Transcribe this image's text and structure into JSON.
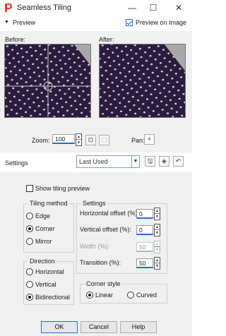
{
  "window": {
    "title": "Seamless Tiling",
    "minimize_glyph": "—",
    "maximize_glyph": "☐",
    "close_glyph": "✕"
  },
  "preview": {
    "header_label": "Preview",
    "preview_on_image_label": "Preview on Image",
    "preview_on_image_checked": true,
    "before_label": "Before:",
    "after_label": "After:",
    "zoom_label": "Zoom:",
    "zoom_value": "100",
    "pan_label": "Pan:",
    "pan_glyph": "+"
  },
  "settings": {
    "label": "Settings",
    "preset_value": "Last Used"
  },
  "tiling": {
    "show_tiling_preview_label": "Show tiling preview",
    "show_tiling_preview_checked": false,
    "method_title": "Tiling method",
    "methods": [
      "Edge",
      "Corner",
      "Mirror"
    ],
    "method_selected": "Corner",
    "direction_title": "Direction",
    "directions": [
      "Horizontal",
      "Vertical",
      "Bidirectional"
    ],
    "direction_selected": "Bidirectional",
    "settings_title": "Settings",
    "horizontal_offset_label": "Horizontal offset (%):",
    "horizontal_offset_value": "0",
    "vertical_offset_label": "Vertical offset (%):",
    "vertical_offset_value": "0",
    "width_label": "Width (%):",
    "width_value": "50",
    "transition_label": "Transition (%):",
    "transition_value": "50",
    "corner_style_title": "Corner style",
    "corner_styles": [
      "Linear",
      "Curved"
    ],
    "corner_style_selected": "Linear"
  },
  "buttons": {
    "ok": "OK",
    "cancel": "Cancel",
    "help": "Help"
  },
  "colors": {
    "accent": "#1f6fd1",
    "fabric": "#2a1b3f",
    "dot": "#d8cfc6"
  }
}
